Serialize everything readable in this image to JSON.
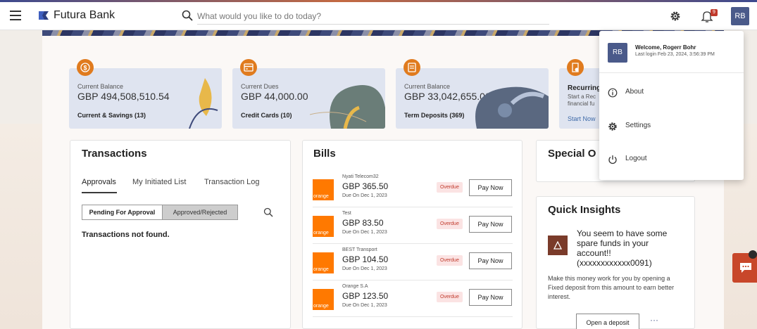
{
  "header": {
    "brand": "Futura Bank",
    "search_placeholder": "What would you like to do today?",
    "notification_count": "9",
    "avatar_initials": "RB"
  },
  "cards": [
    {
      "label": "Current Balance",
      "amount": "GBP 494,508,510.54",
      "link": "Current & Savings (13)",
      "icon": "dollar-icon"
    },
    {
      "label": "Current Dues",
      "amount": "GBP 44,000.00",
      "link": "Credit Cards (10)",
      "icon": "credit-card-icon"
    },
    {
      "label": "Current Balance",
      "amount": "GBP 33,042,655.00",
      "link": "Term Deposits (369)",
      "icon": "deposit-icon"
    },
    {
      "label": "Recurring",
      "desc_1": "Start a Rec",
      "desc_2": "financial fu",
      "link": "Start Now",
      "icon": "recurring-icon"
    }
  ],
  "transactions": {
    "title": "Transactions",
    "tabs": [
      "Approvals",
      "My Initiated List",
      "Transaction Log"
    ],
    "toggle": [
      "Pending For Approval",
      "Approved/Rejected"
    ],
    "empty": "Transactions not found."
  },
  "bills": {
    "title": "Bills",
    "items": [
      {
        "name": "Nyati Telecom32",
        "amount": "GBP 365.50",
        "due": "Due On Dec 1, 2023",
        "status": "Overdue",
        "action": "Pay Now",
        "logo_text": "orange"
      },
      {
        "name": "Test",
        "amount": "GBP 83.50",
        "due": "Due On Dec 1, 2023",
        "status": "Overdue",
        "action": "Pay Now",
        "logo_text": "orange"
      },
      {
        "name": "BEST Transport",
        "amount": "GBP 104.50",
        "due": "Due On Dec 1, 2023",
        "status": "Overdue",
        "action": "Pay Now",
        "logo_text": "orange"
      },
      {
        "name": "Orange S.A",
        "amount": "GBP 123.50",
        "due": "Due On Dec 1, 2023",
        "status": "Overdue",
        "action": "Pay Now",
        "logo_text": "orange"
      }
    ]
  },
  "special_offers": {
    "title": "Special O"
  },
  "quick_insights": {
    "title": "Quick Insights",
    "headline": "You seem to have some spare funds in your account!! (xxxxxxxxxxxx0091)",
    "body": "Make this money work for you by opening a Fixed deposit from this amount to earn better interest.",
    "button": "Open a deposit",
    "more": "···"
  },
  "user_menu": {
    "initials": "RB",
    "welcome": "Welcome, Rogerr Bohr",
    "last_login": "Last login Feb 23, 2024, 3:56:39 PM",
    "items": [
      {
        "label": "About",
        "icon": "info-icon"
      },
      {
        "label": "Settings",
        "icon": "gear-icon"
      },
      {
        "label": "Logout",
        "icon": "power-icon"
      }
    ]
  },
  "colors": {
    "accent_orange": "#e07b1e",
    "brand_navy": "#4a5a8a",
    "overdue_red": "#c0392b",
    "orange_logo": "#ff7900",
    "card_bg": "#dfe4f0"
  }
}
